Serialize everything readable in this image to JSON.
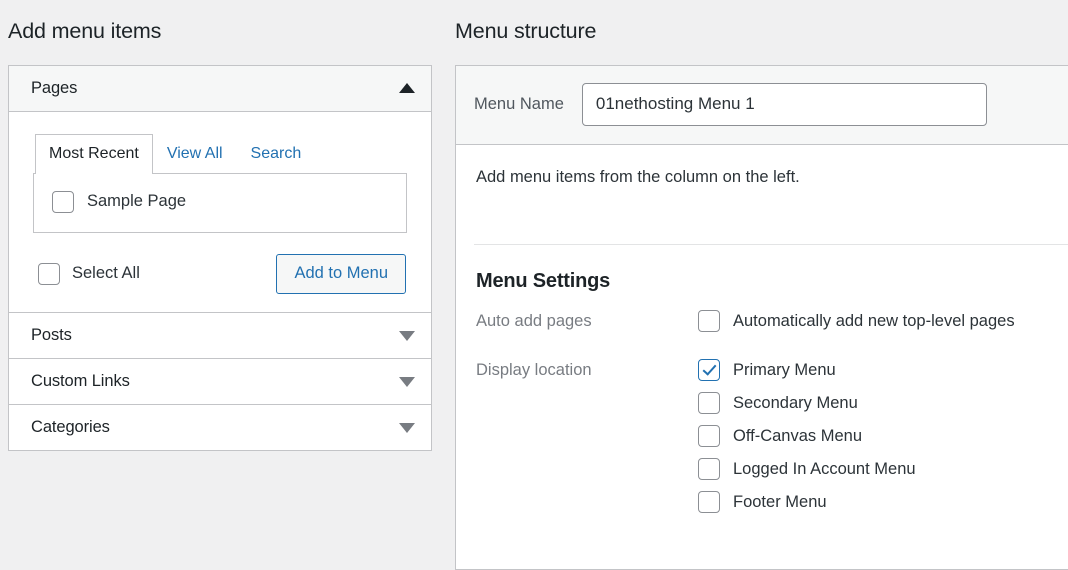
{
  "left": {
    "heading": "Add menu items",
    "panels": [
      {
        "title": "Pages",
        "state": "expanded",
        "icon": "triangle-up-icon",
        "tabs": [
          {
            "label": "Most Recent",
            "active": true
          },
          {
            "label": "View All",
            "active": false
          },
          {
            "label": "Search",
            "active": false
          }
        ],
        "items": [
          {
            "label": "Sample Page",
            "checked": false
          }
        ],
        "select_all_label": "Select All",
        "select_all_checked": false,
        "add_button_label": "Add to Menu"
      },
      {
        "title": "Posts",
        "state": "collapsed",
        "icon": "triangle-down-icon"
      },
      {
        "title": "Custom Links",
        "state": "collapsed",
        "icon": "triangle-down-icon"
      },
      {
        "title": "Categories",
        "state": "collapsed",
        "icon": "triangle-down-icon"
      }
    ]
  },
  "right": {
    "heading": "Menu structure",
    "menu_name_label": "Menu Name",
    "menu_name_value": "01nethosting Menu 1",
    "menu_name_placeholder": "Menu Name",
    "hint": "Add menu items from the column on the left.",
    "settings_title": "Menu Settings",
    "auto_add": {
      "label": "Auto add pages",
      "option_label": "Automatically add new top-level pages",
      "checked": false
    },
    "display_location": {
      "label": "Display location",
      "options": [
        {
          "label": "Primary Menu",
          "checked": true
        },
        {
          "label": "Secondary Menu",
          "checked": false
        },
        {
          "label": "Off-Canvas Menu",
          "checked": false
        },
        {
          "label": "Logged In Account Menu",
          "checked": false
        },
        {
          "label": "Footer Menu",
          "checked": false
        }
      ]
    }
  },
  "colors": {
    "page_bg": "#f0f0f1",
    "panel_bg": "#ffffff",
    "border": "#c3c4c7",
    "accent": "#2271b1",
    "text": "#2c3338",
    "muted": "#787c82"
  }
}
